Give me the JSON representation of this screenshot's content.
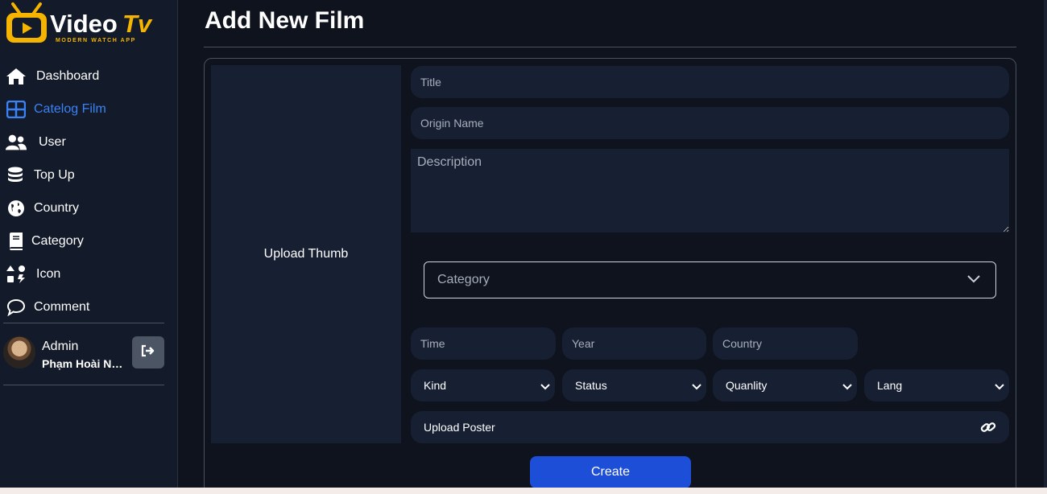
{
  "brand": {
    "name_part1": "Video",
    "name_part2": "Tv",
    "tagline": "MODERN WATCH APP",
    "accent": "#f5b400"
  },
  "sidebar": {
    "items": [
      {
        "label": "Dashboard",
        "icon": "home-icon",
        "active": false
      },
      {
        "label": "Catelog Film",
        "icon": "grid-icon",
        "active": true
      },
      {
        "label": "User",
        "icon": "users-icon",
        "active": false
      },
      {
        "label": "Top Up",
        "icon": "coins-icon",
        "active": false
      },
      {
        "label": "Country",
        "icon": "globe-icon",
        "active": false
      },
      {
        "label": "Category",
        "icon": "book-icon",
        "active": false
      },
      {
        "label": "Icon",
        "icon": "icons-icon",
        "active": false
      },
      {
        "label": "Comment",
        "icon": "comment-icon",
        "active": false
      }
    ],
    "user": {
      "role": "Admin",
      "name": "Phạm Hoài Na..."
    }
  },
  "page": {
    "title": "Add New Film",
    "upload_thumb": "Upload Thumb",
    "fields": {
      "title_placeholder": "Title",
      "origin_name_placeholder": "Origin Name",
      "description_placeholder": "Description",
      "category_select": "Category",
      "time_placeholder": "Time",
      "year_placeholder": "Year",
      "country_placeholder": "Country",
      "kind": "Kind",
      "status": "Status",
      "quality": "Quanlity",
      "lang": "Lang",
      "upload_poster": "Upload Poster"
    },
    "create_label": "Create"
  },
  "colors": {
    "active": "#3b82f6",
    "button": "#1d4ed8",
    "field_bg": "#172033"
  }
}
